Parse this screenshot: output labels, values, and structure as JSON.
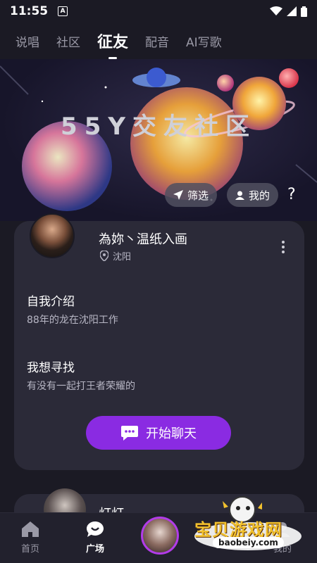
{
  "status_bar": {
    "time": "11:55",
    "notification_badge": "A",
    "icons": [
      "wifi-icon",
      "signal-icon",
      "battery-icon"
    ]
  },
  "tabs": [
    {
      "label": "说唱",
      "active": false
    },
    {
      "label": "社区",
      "active": false
    },
    {
      "label": "征友",
      "active": true
    },
    {
      "label": "配音",
      "active": false
    },
    {
      "label": "AI写歌",
      "active": false
    }
  ],
  "banner": {
    "title": "55Y交友社区",
    "filter_label": "筛选",
    "mine_label": "我的",
    "help_label": "?"
  },
  "profile_card": {
    "username": "為妳丶温纸入画",
    "location": "沈阳",
    "intro_title": "自我介绍",
    "intro_text": "88年的龙在沈阳工作",
    "seeking_title": "我想寻找",
    "seeking_text": "有没有一起打王者荣耀的",
    "chat_button": "开始聊天"
  },
  "next_card": {
    "username": "灯灯"
  },
  "bottom_nav": {
    "items": [
      {
        "label": "首页",
        "icon": "home-icon",
        "active": false
      },
      {
        "label": "广场",
        "icon": "chat-bubble-icon",
        "active": true
      },
      {
        "label": "",
        "icon": "center-avatar",
        "active": false
      },
      {
        "label": "消息",
        "icon": "message-icon",
        "active": false
      },
      {
        "label": "我的",
        "icon": "profile-icon",
        "active": false
      }
    ]
  },
  "watermark": {
    "text": "宝贝游戏网",
    "url": "baobeiy.com"
  },
  "colors": {
    "background": "#1b1a24",
    "card": "#2b2a38",
    "accent": "#8a2be2"
  }
}
